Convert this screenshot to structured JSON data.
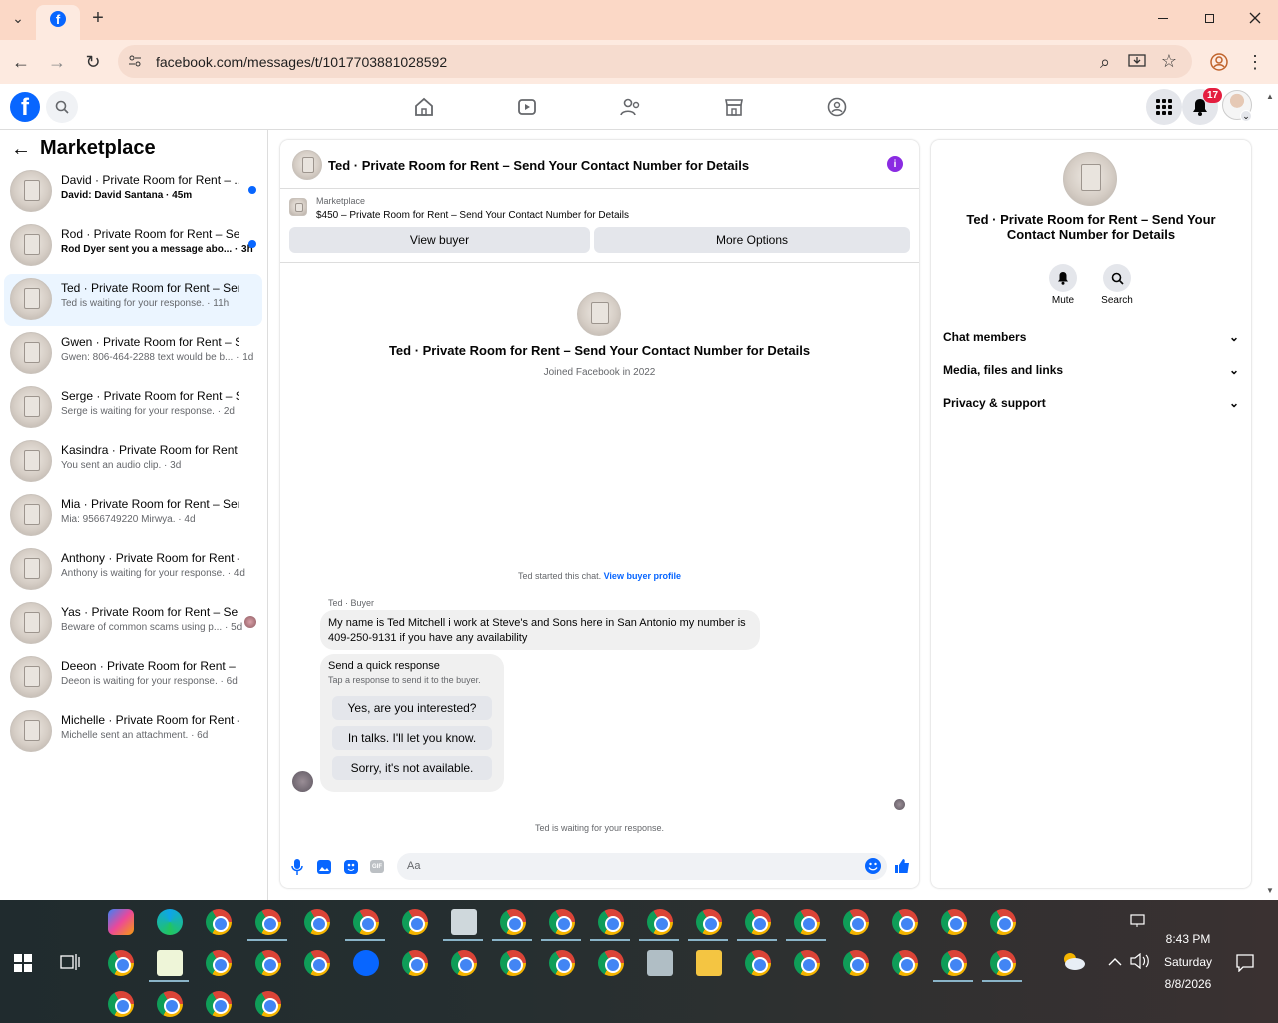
{
  "browser": {
    "url": "facebook.com/messages/t/1017703881028592",
    "new_tab": "+",
    "dropdown": "⌄",
    "back": "←",
    "forward": "→",
    "reload": "↻",
    "zoom_icon": "⌕",
    "bookmark": "☆",
    "menu": "⋮"
  },
  "fb": {
    "logo": "f",
    "notif_count": "17"
  },
  "marketplace": {
    "title": "Marketplace",
    "back_arrow": "←",
    "conversations": [
      {
        "title": "David · Private Room for Rent – ...",
        "preview": "David: David Santana · 45m",
        "unread": true
      },
      {
        "title": "Rod · Private Room for Rent – Se...",
        "preview": "Rod Dyer sent you a message abo... · 3h",
        "unread": true
      },
      {
        "title": "Ted · Private Room for Rent – Send...",
        "preview": "Ted is waiting for your response. · 11h",
        "selected": true
      },
      {
        "title": "Gwen · Private Room for Rent – Se...",
        "preview": "Gwen: 806-464-2288 text would be b... · 1d"
      },
      {
        "title": "Serge · Private Room for Rent – Se...",
        "preview": "Serge is waiting for your response. · 2d"
      },
      {
        "title": "Kasindra · Private Room for Rent –...",
        "preview": "You sent an audio clip. · 3d"
      },
      {
        "title": "Mia · Private Room for Rent – Sen...",
        "preview": "Mia: 9566749220 Mirwya. · 4d"
      },
      {
        "title": "Anthony · Private Room for Rent –...",
        "preview": "Anthony is waiting for your response. · 4d"
      },
      {
        "title": "Yas · Private Room for Rent – Se...",
        "preview": "Beware of common scams using p... · 5d"
      },
      {
        "title": "Deeon · Private Room for Rent – S...",
        "preview": "Deeon is waiting for your response. · 6d"
      },
      {
        "title": "Michelle · Private Room for Rent – ...",
        "preview": "Michelle sent an attachment. · 6d"
      }
    ]
  },
  "chat": {
    "header_title": "Ted · Private Room for Rent – Send Your Contact Number for Details",
    "info_icon": "i",
    "listing_source": "Marketplace",
    "listing_text": "$450 – Private Room for Rent – Send Your Contact Number for Details",
    "view_buyer": "View buyer",
    "more_options": "More Options",
    "profile_name": "Ted · Private Room for Rent – Send Your Contact Number for Details",
    "joined": "Joined Facebook in 2022",
    "started_text": "Ted started this chat.",
    "view_profile_link": "View buyer profile",
    "sender_label": "Ted · Buyer",
    "message": "My name is Ted Mitchell i work at Steve's and Sons here in San Antonio my number is 409-250-9131 if you have any availability",
    "quick_title": "Send a quick response",
    "quick_sub": "Tap a response to send it to the buyer.",
    "quick_responses": [
      "Yes, are you interested?",
      "In talks. I'll let you know.",
      "Sorry, it's not available."
    ],
    "waiting": "Ted is waiting for your response.",
    "input_placeholder": "Aa",
    "gif": "GIF"
  },
  "info": {
    "title": "Ted · Private Room for Rent – Send Your Contact Number for Details",
    "mute": "Mute",
    "search": "Search",
    "sections": [
      "Chat members",
      "Media, files and links",
      "Privacy & support"
    ],
    "chevron": "⌄"
  },
  "taskbar": {
    "time": "8:43 PM",
    "day": "Saturday",
    "date": "8/8/2026"
  },
  "colors": {
    "fb_blue": "#0866ff",
    "tabbar": "#fbd8c6",
    "toolbar": "#fdeae0",
    "info_purple": "#8a2be2"
  }
}
